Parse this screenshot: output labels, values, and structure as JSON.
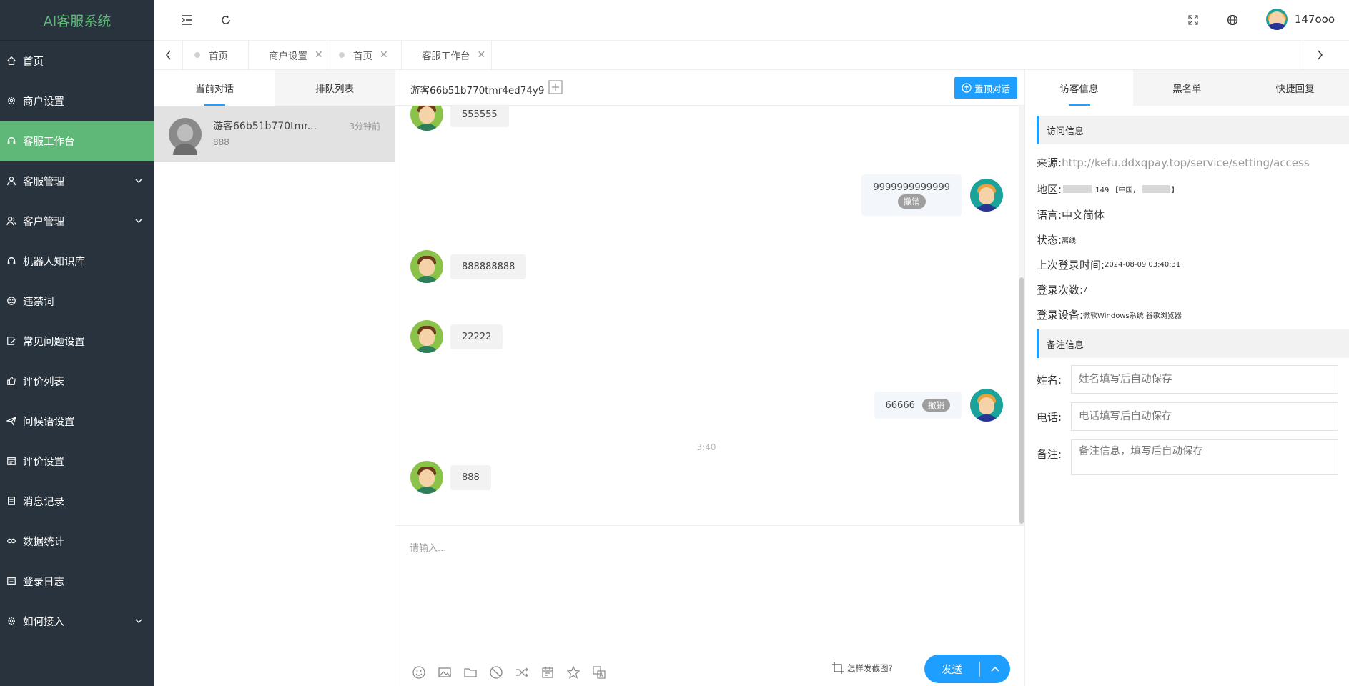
{
  "brand": "AI客服系统",
  "menu": [
    {
      "label": "首页",
      "icon": "home-icon"
    },
    {
      "label": "商户设置",
      "icon": "gear-icon"
    },
    {
      "label": "客服工作台",
      "icon": "headset-icon",
      "active": true
    },
    {
      "label": "客服管理",
      "icon": "user-icon",
      "expandable": true
    },
    {
      "label": "客户管理",
      "icon": "users-icon",
      "expandable": true
    },
    {
      "label": "机器人知识库",
      "icon": "robot-icon"
    },
    {
      "label": "违禁词",
      "icon": "sad-face-icon"
    },
    {
      "label": "常见问题设置",
      "icon": "edit-icon"
    },
    {
      "label": "评价列表",
      "icon": "thumbs-up-icon"
    },
    {
      "label": "问候语设置",
      "icon": "send-icon"
    },
    {
      "label": "评价设置",
      "icon": "calendar-icon"
    },
    {
      "label": "消息记录",
      "icon": "document-icon"
    },
    {
      "label": "数据统计",
      "icon": "link-icon"
    },
    {
      "label": "登录日志",
      "icon": "log-icon"
    },
    {
      "label": "如何接入",
      "icon": "gear-icon",
      "expandable": true
    }
  ],
  "header": {
    "username": "147ooo"
  },
  "tabs": [
    {
      "label": "首页",
      "closable": false
    },
    {
      "label": "商户设置",
      "closable": true
    },
    {
      "label": "首页",
      "closable": true
    },
    {
      "label": "客服工作台",
      "closable": true,
      "active": true
    }
  ],
  "conversation": {
    "tabs": [
      "当前对话",
      "排队列表"
    ],
    "items": [
      {
        "name": "游客66b51b770tmr...",
        "time": "3分钟前",
        "last": "888"
      }
    ]
  },
  "chat": {
    "title": "游客66b51b770tmr4ed74y9",
    "top_button": "置顶对话",
    "revoke_label": "撤销",
    "messages": [
      {
        "side": "left",
        "text": "555555"
      },
      {
        "side": "right",
        "text": "9999999999999",
        "revocable": true
      },
      {
        "side": "left",
        "text": "888888888"
      },
      {
        "side": "left",
        "text": "22222"
      },
      {
        "side": "right",
        "text": "66666",
        "revocable": true
      },
      {
        "side": "left",
        "text": "888"
      }
    ],
    "time_separator": "3:40",
    "input_placeholder": "请输入...",
    "screenshot_help": "怎样发截图?",
    "send_label": "发送",
    "toolbar_icons": [
      "emoji-icon",
      "image-icon",
      "folder-icon",
      "block-icon",
      "transfer-icon",
      "calendar-icon",
      "star-icon",
      "translate-icon"
    ]
  },
  "info": {
    "tabs": [
      "访客信息",
      "黑名单",
      "快捷回复"
    ],
    "visit_section": "访问信息",
    "source_label": "来源:",
    "source_value": "http://kefu.ddxqpay.top/service/setting/access",
    "region_label": "地区:",
    "region_value": ".149 【中国，",
    "language_label": "语言:",
    "language_value": "中文简体",
    "status_label": "状态:",
    "status_value": "离线",
    "last_login_label": "上次登录时间:",
    "last_login_value": "2024-08-09 03:40:31",
    "login_count_label": "登录次数:",
    "login_count_value": "7",
    "device_label": "登录设备:",
    "device_value": "微软Windows系统 谷歌浏览器",
    "note_section": "备注信息",
    "name_label": "姓名:",
    "name_placeholder": "姓名填写后自动保存",
    "phone_label": "电话:",
    "phone_placeholder": "电话填写后自动保存",
    "remark_label": "备注:",
    "remark_placeholder": "备注信息，填写后自动保存"
  },
  "colors": {
    "sidebar": "#28333e",
    "active": "#5fb878",
    "accent": "#1e9fff"
  }
}
